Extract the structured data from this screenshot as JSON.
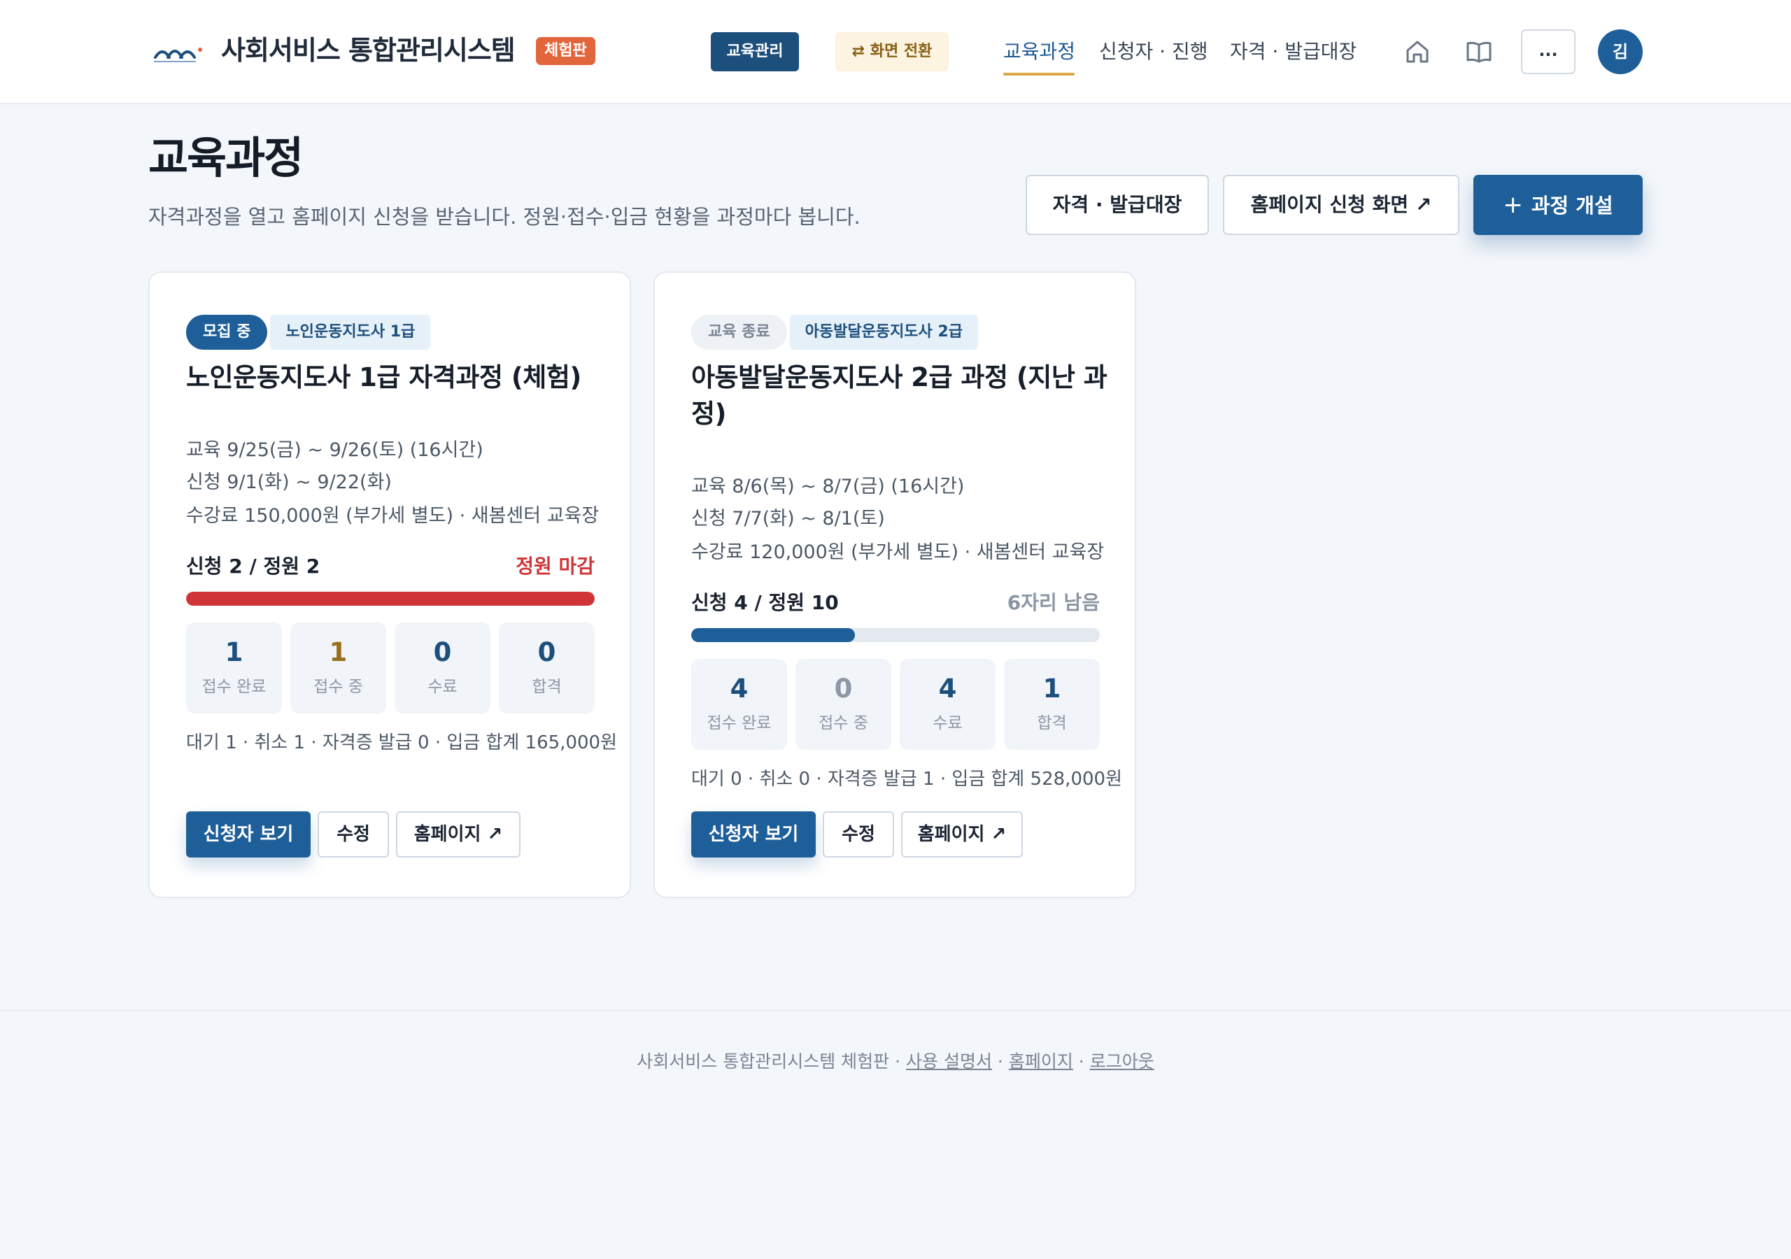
{
  "header": {
    "brand": "사회서비스 통합관리시스템",
    "brand_badge": "체험판",
    "edu_admin": "교육관리",
    "switch_view": "⇄ 화면 전환",
    "nav": [
      "교육과정",
      "신청자 · 진행",
      "자격 · 발급대장"
    ],
    "more": "...",
    "avatar": "김"
  },
  "page": {
    "title": "교육과정",
    "description": "자격과정을 열고 홈페이지 신청을 받습니다. 정원·접수·입금 현황을 과정마다 봅니다.",
    "btn_ledger": "자격 · 발급대장",
    "btn_homepage": "홈페이지 신청 화면 ↗",
    "btn_new_plus": "+",
    "btn_new": "과정 개설"
  },
  "courses": [
    {
      "status": "모집 중",
      "cert": "노인운동지도사 1급",
      "title": "노인운동지도사 1급 자격과정 (체험)",
      "edu_period": "교육 9/25(금) ~ 9/26(토) (16시간)",
      "apply_period": "신청 9/1(화) ~ 9/22(화)",
      "fee_place": "수강료 150,000원 (부가세 별도) · 새봄센터 교육장",
      "capacity_text": "신청 2 / 정원 2",
      "capacity_status": "정원 마감",
      "fill_ratio": 1.0,
      "fill_color": "#d13438",
      "stats": [
        {
          "num": "1",
          "label": "접수 완료",
          "color": "#1d4f7c"
        },
        {
          "num": "1",
          "label": "접수 중",
          "color": "#9a6f1c"
        },
        {
          "num": "0",
          "label": "수료",
          "color": "#1d4f7c"
        },
        {
          "num": "0",
          "label": "합격",
          "color": "#1d4f7c"
        }
      ],
      "summary": "대기 1 · 취소 1 · 자격증 발급 0 · 입금 합계 165,000원",
      "btn_applicants": "신청자 보기",
      "btn_edit": "수정",
      "btn_homepage": "홈페이지 ↗"
    },
    {
      "status": "교육 종료",
      "cert": "아동발달운동지도사 2급",
      "title": "아동발달운동지도사 2급 과정 (지난 과정)",
      "edu_period": "교육 8/6(목) ~ 8/7(금) (16시간)",
      "apply_period": "신청 7/7(화) ~ 8/1(토)",
      "fee_place": "수강료 120,000원 (부가세 별도) · 새봄센터 교육장",
      "capacity_text": "신청 4 / 정원 10",
      "capacity_status": "6자리 남음",
      "fill_ratio": 0.4,
      "fill_color": "#1f5f99",
      "stats": [
        {
          "num": "4",
          "label": "접수 완료",
          "color": "#1d4f7c"
        },
        {
          "num": "0",
          "label": "접수 중",
          "color": "#8d97a6"
        },
        {
          "num": "4",
          "label": "수료",
          "color": "#1d4f7c"
        },
        {
          "num": "1",
          "label": "합격",
          "color": "#1d4f7c"
        }
      ],
      "summary": "대기 0 · 취소 0 · 자격증 발급 1 · 입금 합계 528,000원",
      "btn_applicants": "신청자 보기",
      "btn_edit": "수정",
      "btn_homepage": "홈페이지 ↗"
    }
  ],
  "footer": {
    "text": "사회서비스 통합관리시스템 체험판 · ",
    "link_manual": "사용 설명서",
    "sep": " · ",
    "link_homepage": "홈페이지",
    "link_logout": "로그아웃"
  }
}
